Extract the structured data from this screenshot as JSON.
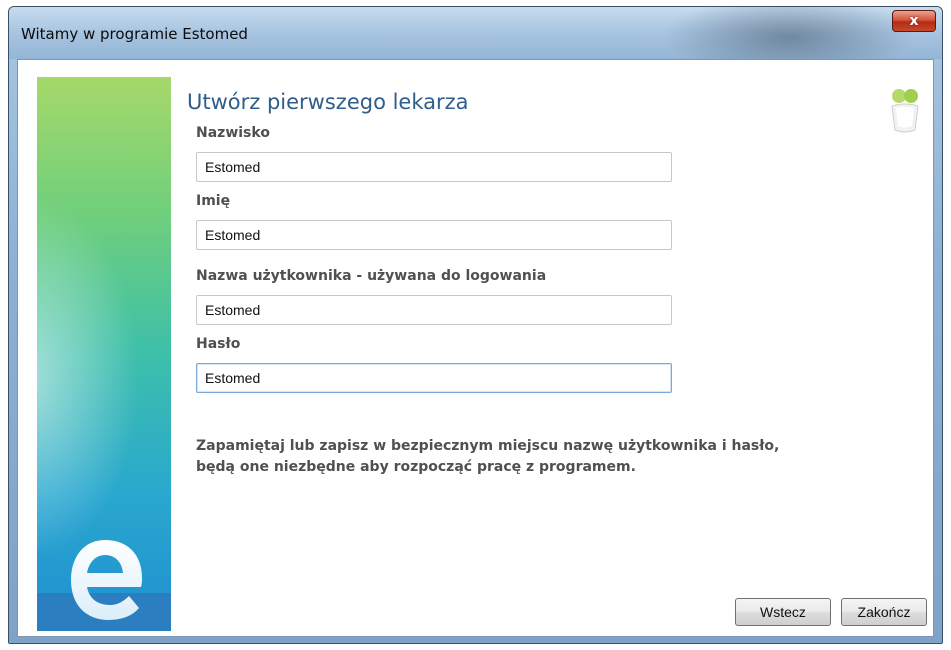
{
  "window": {
    "title": "Witamy w programie Estomed",
    "close_label": "x"
  },
  "page": {
    "heading": "Utwórz pierwszego lekarza"
  },
  "form": {
    "surname": {
      "label": "Nazwisko",
      "value": "Estomed"
    },
    "first_name": {
      "label": "Imię",
      "value": "Estomed"
    },
    "username": {
      "label": "Nazwa użytkownika - używana do logowania",
      "value": "Estomed"
    },
    "password": {
      "label": "Hasło",
      "value": "Estomed"
    }
  },
  "notice": {
    "line1": "Zapamiętaj lub zapisz w bezpiecznym miejscu nazwę użytkownika i hasło,",
    "line2": "będą one niezbędne aby rozpocząć pracę z programem."
  },
  "buttons": {
    "back": "Wstecz",
    "finish": "Zakończ"
  },
  "icons": {
    "close": "close-icon",
    "logo": "estomed-logo-icon",
    "help": "assistant-icon"
  },
  "colors": {
    "heading": "#2f5d8c",
    "label": "#505050",
    "close_button": "#c6472b"
  }
}
